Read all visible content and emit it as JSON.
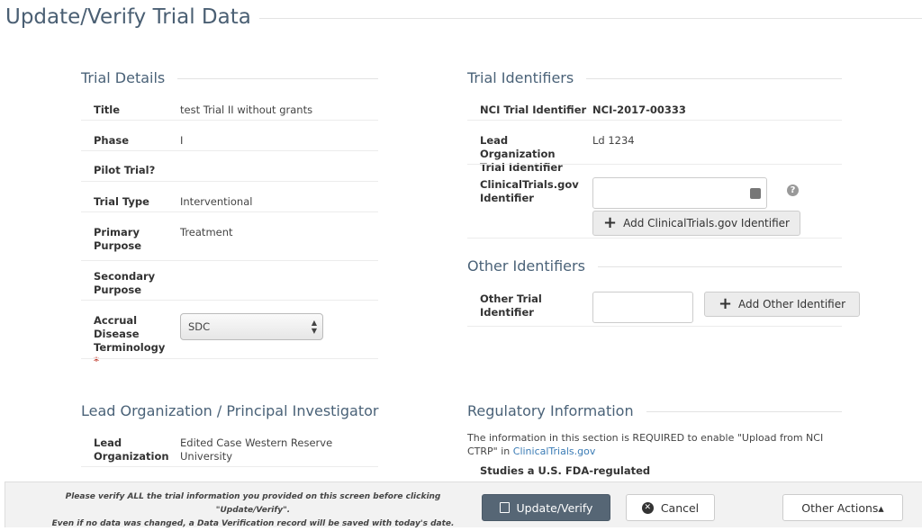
{
  "page": {
    "title": "Update/Verify Trial Data"
  },
  "trial_details": {
    "heading": "Trial Details",
    "rows": [
      {
        "label": "Title",
        "value": "test Trial II without grants"
      },
      {
        "label": "Phase",
        "value": "I"
      },
      {
        "label": "Pilot Trial?",
        "value": ""
      },
      {
        "label": "Trial Type",
        "value": "Interventional"
      },
      {
        "label": "Primary Purpose",
        "value": "Treatment"
      },
      {
        "label": "Secondary Purpose",
        "value": ""
      },
      {
        "label": "Accrual Disease Terminology",
        "value": "SDC",
        "required_mark": "*"
      }
    ]
  },
  "trial_identifiers": {
    "heading": "Trial Identifiers",
    "nci_label": "NCI Trial Identifier",
    "nci_value": "NCI-2017-00333",
    "lead_label": "Lead Organization Trial Identifier",
    "lead_value": "Ld 1234",
    "ctgov_label": "ClinicalTrials.gov Identifier",
    "ctgov_value": "",
    "ctgov_button": "Add ClinicalTrials.gov Identifier"
  },
  "other_identifiers": {
    "heading": "Other Identifiers",
    "label": "Other Trial Identifier",
    "value": "",
    "button": "Add Other Identifier"
  },
  "lead_org": {
    "heading": "Lead Organization / Principal Investigator",
    "label": "Lead Organization",
    "value": "Edited Case Western Reserve University"
  },
  "regulatory": {
    "heading": "Regulatory Information",
    "note_pre": "The information in this section is REQUIRED to enable \"Upload from NCI CTRP\" in ",
    "note_link": "ClinicalTrials.gov",
    "field_label": "Studies a U.S. FDA-regulated"
  },
  "footer": {
    "note_line1": "Please verify ALL the trial information you provided on this screen before clicking \"Update/Verify\".",
    "note_line2": "Even if no data was changed, a Data Verification record will be saved with today's date.",
    "update_button": "Update/Verify",
    "cancel_button": "Cancel",
    "other_actions": "Other Actions▴",
    "primary_color": "#566675"
  }
}
